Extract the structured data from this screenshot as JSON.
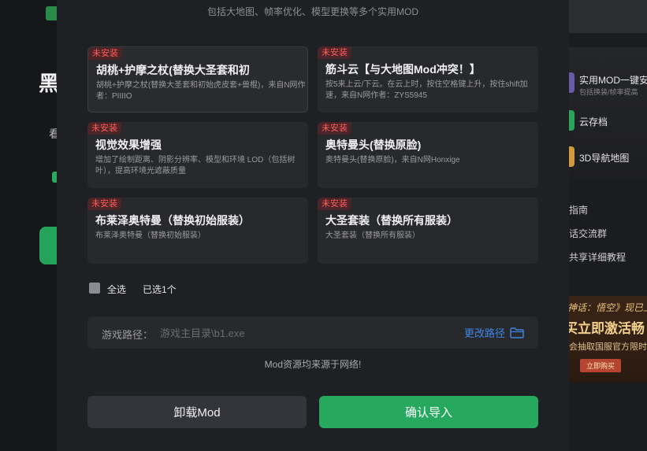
{
  "background": {
    "left_big_char": "黑",
    "right_sidebar": {
      "items": [
        {
          "label": "实用MOD一键安",
          "sub": "包括换装/帧率提高"
        },
        {
          "label": "云存档"
        },
        {
          "label": "3D导航地图"
        }
      ],
      "links": [
        "指南",
        "话交流群",
        "共享详细教程"
      ],
      "banner": {
        "line1": "神话：悟空》现已上",
        "line2": "买立即激活畅",
        "line3": "会抽取国服官方限时",
        "button": "立即购买"
      }
    }
  },
  "modal": {
    "subtitle": "包括大地图、帧率优化、模型更换等多个实用MOD",
    "mods": [
      {
        "badge": "未安装",
        "title": "胡桃+护摩之杖(替换大圣套和初",
        "desc": "胡桃+护摩之杖(替换大圣套和初始虎皮套+兽棍)，来自N网作者：PIIIIO",
        "highlighted": true
      },
      {
        "badge": "未安装",
        "title": "筋斗云【与大地图Mod冲突！】",
        "desc": "按5来上云/下云。在云上时，按住空格键上升，按住shift加速，来自N网作者：ZYS5945",
        "highlighted": false
      },
      {
        "badge": "未安装",
        "title": "视觉效果增强",
        "desc": "增加了绘制距离、阴影分辨率、模型和环境 LOD（包括树叶），提高环境光遮蔽质量",
        "highlighted": false
      },
      {
        "badge": "未安装",
        "title": "奥特曼头(替换原脸)",
        "desc": "奥特曼头(替换原脸)，来自N网Honxige",
        "highlighted": false
      },
      {
        "badge": "未安装",
        "title": "布莱泽奥特曼（替换初始服装）",
        "desc": "布莱泽奥特曼（替换初始服装）",
        "highlighted": false
      },
      {
        "badge": "未安装",
        "title": "大圣套装（替换所有服装）",
        "desc": "大圣套装（替换所有服装）",
        "highlighted": false
      }
    ],
    "select_all": "全选",
    "selected_count": "已选1个",
    "path": {
      "label": "游戏路径：",
      "placeholder": "游戏主目录\\b1.exe",
      "value": "",
      "change": "更改路径"
    },
    "note": "Mod资源均来源于网络!",
    "uninstall_button": "卸载Mod",
    "confirm_button": "确认导入"
  },
  "colors": {
    "accent_green": "#27a85f",
    "link_blue": "#3f86e8",
    "badge_red": "#ff5c5c",
    "modal_bg": "#1f2023",
    "card_bg": "#28292d"
  }
}
